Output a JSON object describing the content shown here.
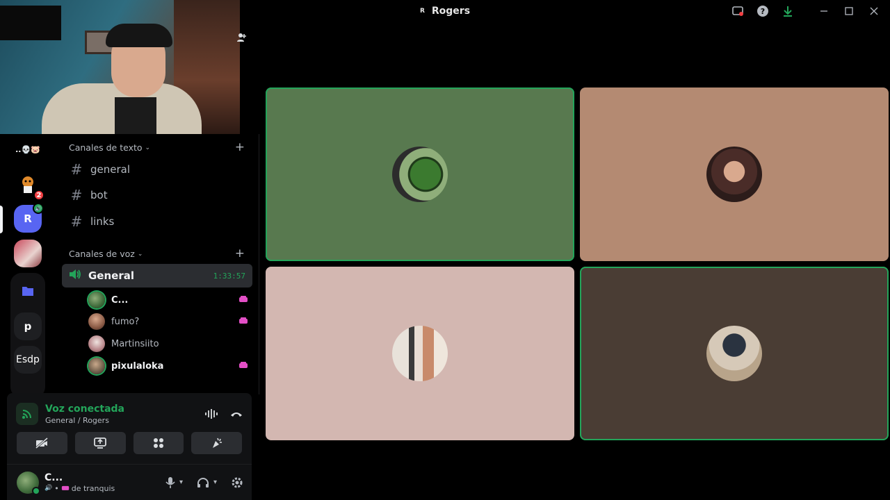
{
  "window": {
    "title": "Rogers",
    "server_initial": "R"
  },
  "server_rail": {
    "items": [
      {
        "label": "..💀🐷",
        "kind": "folder-text"
      },
      {
        "label": "",
        "kind": "image",
        "badge": "2"
      },
      {
        "label": "R",
        "kind": "active",
        "color": "#5865f2"
      },
      {
        "label": "",
        "kind": "image"
      },
      {
        "label": "",
        "kind": "folder-icon"
      },
      {
        "label": "p",
        "kind": "text"
      },
      {
        "label": "Esdp",
        "kind": "text"
      }
    ]
  },
  "channels": {
    "text_category": "Canales de texto",
    "text_channels": [
      {
        "name": "general"
      },
      {
        "name": "bot"
      },
      {
        "name": "links"
      }
    ],
    "voice_category": "Canales de voz",
    "voice_channel": {
      "name": "General",
      "timer": "1:33:57"
    },
    "members": [
      {
        "name": "C...",
        "highlighted": true,
        "activity": true,
        "speaking": true,
        "avatar_color": "#5e7c4f"
      },
      {
        "name": "fumo?",
        "highlighted": false,
        "activity": true,
        "speaking": false,
        "avatar_color": "#9c6f5a"
      },
      {
        "name": "Martinsiito",
        "highlighted": false,
        "activity": false,
        "speaking": false,
        "avatar_color": "#c9a5a2"
      },
      {
        "name": "pixulaloka",
        "highlighted": true,
        "activity": true,
        "speaking": true,
        "avatar_color": "#6a5a48"
      }
    ]
  },
  "voice_panel": {
    "status": "Voz conectada",
    "location": "General / Rogers"
  },
  "user": {
    "name": "C...",
    "status_text": "de tranquis"
  },
  "tiles": [
    {
      "bg": "#58794f",
      "speaking": true,
      "avatar_color": "#4b7a3a"
    },
    {
      "bg": "#b48a72",
      "speaking": false,
      "avatar_color": "#3a2a28"
    },
    {
      "bg": "#d3b7b1",
      "speaking": false,
      "avatar_color": "#c8a88a"
    },
    {
      "bg": "#4a3d34",
      "speaking": true,
      "avatar_color": "#d6c9b8"
    }
  ],
  "colors": {
    "accent_green": "#23a55a",
    "brand_blurple": "#5865f2",
    "nitro_pink": "#e34fc6"
  },
  "icons": {
    "channel": "hash-icon",
    "voice": "speaker-icon",
    "mic": "microphone-icon",
    "headset": "headphones-icon",
    "settings": "gear-icon"
  }
}
